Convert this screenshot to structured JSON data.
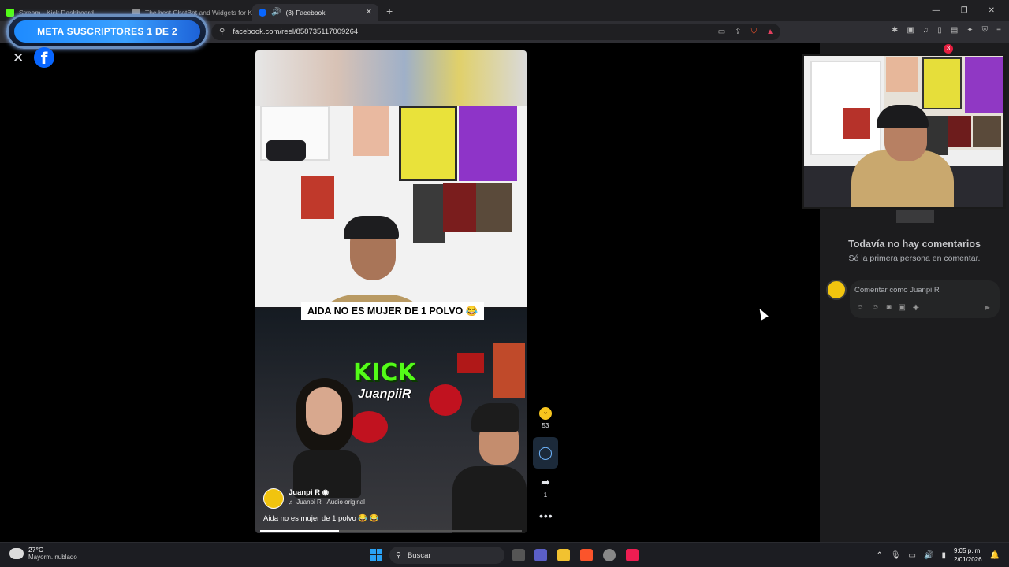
{
  "browser": {
    "tabs": [
      {
        "title": "Stream - Kick Dashboard",
        "color": "#53fc18",
        "active": false
      },
      {
        "title": "The best ChatBot and Widgets for Ki",
        "color": "#8e8e8e",
        "active": false
      },
      {
        "title": "(3) Facebook",
        "color": "#0866ff",
        "active": true
      }
    ],
    "url": "facebook.com/reel/858735117009264"
  },
  "overlay": {
    "meta_label": "META SUSCRIPTORES 1 DE 2"
  },
  "reel": {
    "caption_banner": "AIDA NO ES MUJER DE 1 POLVO 😂",
    "stream_brand": "KICK",
    "stream_name": "JuanpiiR",
    "author_name": "Juanpi R",
    "audio": "♬ Juanpi R · Audio original",
    "description": "Aida no es mujer de 1 polvo 😂 😂",
    "progress": 0.3,
    "reactions_count": "53",
    "shares_count": "1"
  },
  "notifications": {
    "count": "3"
  },
  "comments": {
    "empty_title": "Todavía no hay comentarios",
    "empty_subtitle": "Sé la primera persona en comentar.",
    "placeholder": "Comentar como Juanpi R"
  },
  "taskbar": {
    "temperature": "27°C",
    "weather": "Mayorm. nublado",
    "search_label": "Buscar",
    "time": "9:05 p. m.",
    "date": "2/01/2026"
  },
  "colors": {
    "facebook_blue": "#0866ff",
    "kick_green": "#53fc18"
  }
}
